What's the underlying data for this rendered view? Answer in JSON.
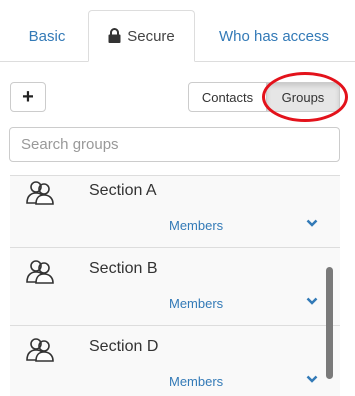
{
  "tabs": {
    "basic": "Basic",
    "secure": "Secure",
    "access": "Who has access"
  },
  "toolbar": {
    "add_label": "+",
    "contacts_label": "Contacts",
    "groups_label": "Groups",
    "active_view": "Groups",
    "highlight_color": "#e3121b"
  },
  "search": {
    "placeholder": "Search groups",
    "value": ""
  },
  "groups": [
    {
      "name": "Section A",
      "members_label": "Members",
      "icon": "group-icon"
    },
    {
      "name": "Section B",
      "members_label": "Members",
      "icon": "group-icon"
    },
    {
      "name": "Section D",
      "members_label": "Members",
      "icon": "group-icon"
    }
  ],
  "colors": {
    "link": "#337ab7",
    "row_bg": "#f9f9f9",
    "border": "#dddddd"
  }
}
